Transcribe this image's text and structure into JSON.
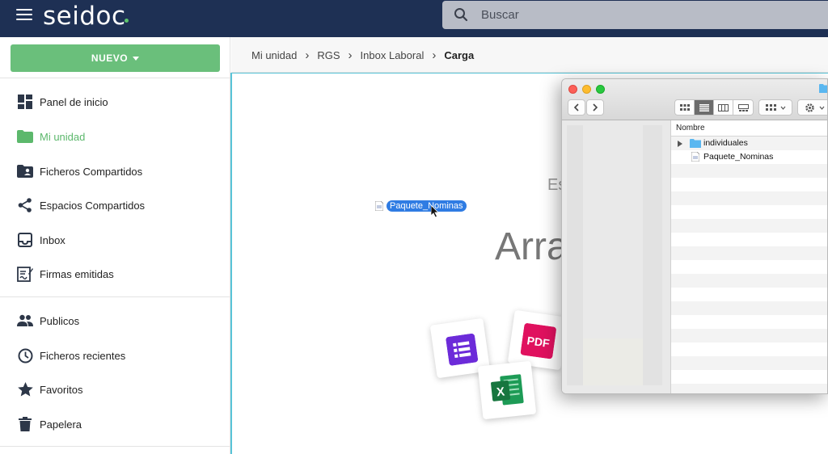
{
  "app": {
    "logo": "seidoc"
  },
  "search": {
    "placeholder": "Buscar"
  },
  "sidebar": {
    "new_button": "NUEVO",
    "items": [
      {
        "label": "Panel de inicio",
        "icon": "dashboard-icon"
      },
      {
        "label": "Mi unidad",
        "icon": "folder-icon",
        "active": true
      },
      {
        "label": "Ficheros Compartidos",
        "icon": "shared-folder-icon"
      },
      {
        "label": "Espacios Compartidos",
        "icon": "share-icon"
      },
      {
        "label": "Inbox",
        "icon": "inbox-icon"
      },
      {
        "label": "Firmas emitidas",
        "icon": "signature-icon"
      },
      {
        "label": "Publicos",
        "icon": "people-icon"
      },
      {
        "label": "Ficheros recientes",
        "icon": "clock-icon"
      },
      {
        "label": "Favoritos",
        "icon": "star-icon"
      },
      {
        "label": "Papelera",
        "icon": "trash-icon"
      }
    ]
  },
  "breadcrumb": [
    "Mi unidad",
    "RGS",
    "Inbox Laboral",
    "Carga"
  ],
  "dropzone": {
    "subtitle": "Es",
    "title": "Arra"
  },
  "drag": {
    "file_label": "Paquete_Nominas"
  },
  "finder": {
    "column_header": "Nombre",
    "rows": [
      {
        "label": "individuales",
        "type": "folder"
      },
      {
        "label": "Paquete_Nominas",
        "type": "file"
      }
    ]
  },
  "colors": {
    "topbar": "#1e3054",
    "accent_green": "#6abf7b",
    "dropzone_border": "#58c4d8",
    "drag_highlight": "#2f7ce3"
  }
}
